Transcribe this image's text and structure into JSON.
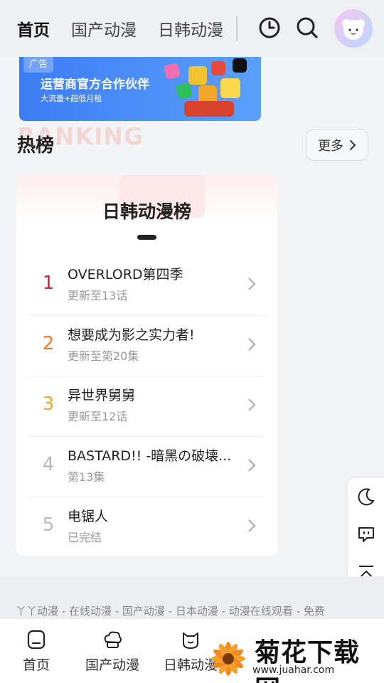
{
  "topnav": {
    "tabs": [
      {
        "label": "首页",
        "active": true
      },
      {
        "label": "国产动漫",
        "active": false
      },
      {
        "label": "日韩动漫",
        "active": false
      }
    ],
    "icons": [
      "history-icon",
      "search-icon",
      "avatar"
    ]
  },
  "banner": {
    "ad_tag": "广告",
    "title": "运营商官方合作伙伴",
    "subtitle": "大流量+超低月租"
  },
  "hot": {
    "bg_text": "RANKING",
    "title": "热榜",
    "more_label": "更多"
  },
  "card": {
    "title": "日韩动漫榜",
    "items": [
      {
        "rank": "1",
        "title": "OVERLORD第四季",
        "sub": "更新至13话",
        "color": "#d4232f"
      },
      {
        "rank": "2",
        "title": "想要成为影之实力者!",
        "sub": "更新至第20集",
        "color": "#ef7a2c"
      },
      {
        "rank": "3",
        "title": "异世界舅舅",
        "sub": "更新至12话",
        "color": "#f1a829"
      },
      {
        "rank": "4",
        "title": "BASTARD!! -暗黑の破壊...",
        "sub": "第13集",
        "color": "#b8b8b8"
      },
      {
        "rank": "5",
        "title": "电锯人",
        "sub": "已完结",
        "color": "#b8b8b8"
      }
    ]
  },
  "footer": {
    "links": "丫丫动漫 - 在线动漫 - 国产动漫 - 日本动漫 - 动漫在线观看 - 免费"
  },
  "bottomnav": {
    "items": [
      {
        "label": "首页",
        "icon": "home-icon"
      },
      {
        "label": "国产动漫",
        "icon": "chinese-anime-icon"
      },
      {
        "label": "日韩动漫",
        "icon": "japanese-anime-icon"
      }
    ]
  },
  "watermark": {
    "text": "菊花下载网",
    "url": "www.juahar.com"
  }
}
